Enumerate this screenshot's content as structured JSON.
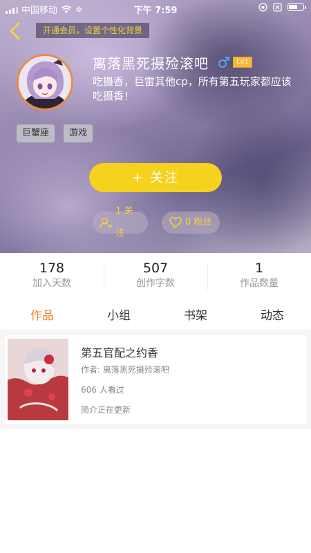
{
  "status_bar": {
    "carrier": "中国移动",
    "time": "下午 7:59"
  },
  "header": {
    "vip_banner": "开通会员，设置个性化背景"
  },
  "profile": {
    "username": "离落黑死摄殓滚吧",
    "level": "Lv1",
    "bio": "吃摄香，巨雷其他cp，所有第五玩家都应该吃摄香！",
    "tags": [
      "巨蟹座",
      "游戏"
    ],
    "follow_button": "+ 关注",
    "following_label": "1 关注",
    "fans_label": "0 粉丝"
  },
  "stats": [
    {
      "value": "178",
      "label": "加入天数"
    },
    {
      "value": "507",
      "label": "创作字数"
    },
    {
      "value": "1",
      "label": "作品数量"
    }
  ],
  "tabs": [
    {
      "label": "作品",
      "active": true
    },
    {
      "label": "小组",
      "active": false
    },
    {
      "label": "书架",
      "active": false
    },
    {
      "label": "动态",
      "active": false
    }
  ],
  "works": [
    {
      "title": "第五官配之约香",
      "author": "作者: 离落黑死摄殓滚吧",
      "views": "606 人看过",
      "intro": "简介正在更新"
    }
  ],
  "colors": {
    "accent_orange": "#f0862d",
    "follow_yellow": "#f4d21e",
    "banner_text": "#f4d23a"
  },
  "icons": {
    "back": "chevron-left-icon",
    "gender": "male-icon",
    "follow_person": "person-add-icon",
    "fans": "heart-chat-icon"
  }
}
